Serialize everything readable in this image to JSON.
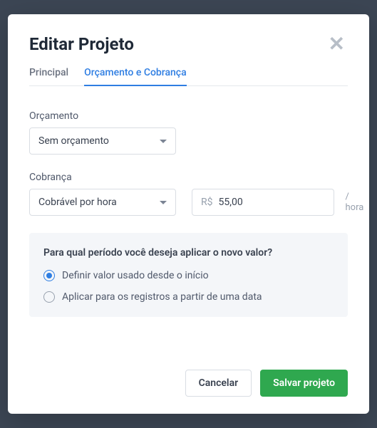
{
  "modal": {
    "title": "Editar Projeto",
    "tabs": {
      "main": "Principal",
      "billing": "Orçamento e Cobrança"
    },
    "budget": {
      "label": "Orçamento",
      "selected": "Sem orçamento"
    },
    "billing": {
      "label": "Cobrança",
      "selected": "Cobrável por hora",
      "currency": "R$",
      "value": "55,00",
      "suffix": "/ hora"
    },
    "period": {
      "title": "Para qual período você deseja aplicar o novo valor?",
      "option1": "Definir valor usado desde o início",
      "option2": "Aplicar para os registros a partir de uma data"
    },
    "buttons": {
      "cancel": "Cancelar",
      "save": "Salvar projeto"
    }
  }
}
